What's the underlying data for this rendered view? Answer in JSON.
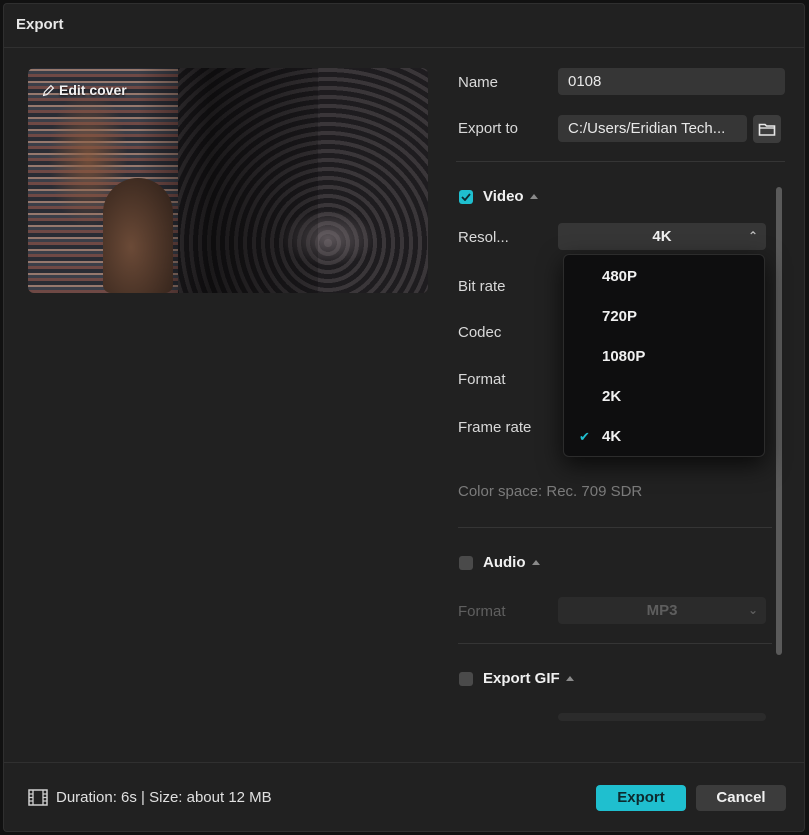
{
  "dialog": {
    "title": "Export"
  },
  "preview": {
    "edit_cover_label": "Edit cover"
  },
  "name": {
    "label": "Name",
    "value": "0108"
  },
  "export_to": {
    "label": "Export to",
    "value": "C:/Users/Eridian Tech..."
  },
  "video": {
    "label": "Video",
    "checked": true,
    "resolution": {
      "label": "Resol...",
      "value": "4K"
    },
    "bitrate_label": "Bit rate",
    "codec_label": "Codec",
    "format_label": "Format",
    "framerate_label": "Frame rate",
    "color_space": "Color space: Rec. 709 SDR"
  },
  "resolution_dropdown": {
    "options": [
      "480P",
      "720P",
      "1080P",
      "2K",
      "4K"
    ],
    "selected": "4K"
  },
  "audio": {
    "label": "Audio",
    "checked": false,
    "format_label": "Format",
    "format_value": "MP3"
  },
  "gif": {
    "label": "Export GIF",
    "checked": false
  },
  "footer": {
    "info": "Duration: 6s | Size: about 12 MB",
    "export_label": "Export",
    "cancel_label": "Cancel"
  },
  "colors": {
    "accent": "#1fbfcf",
    "background": "#212121",
    "field": "#363636"
  }
}
